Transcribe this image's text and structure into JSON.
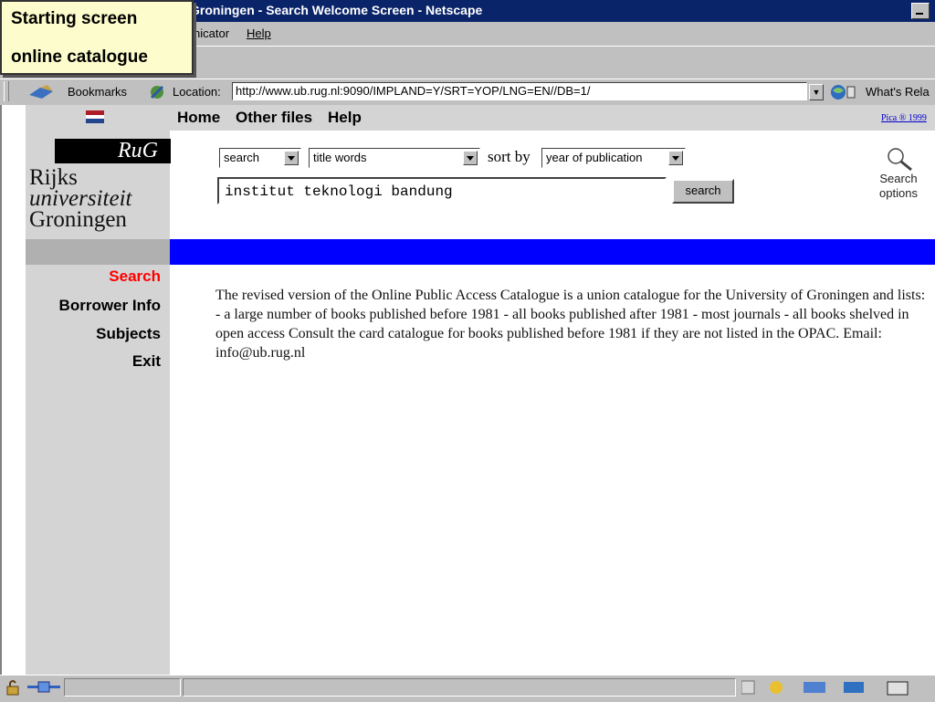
{
  "window": {
    "title": "Groningen - Search Welcome Screen - Netscape"
  },
  "menubar": {
    "items": [
      "nicator",
      "Help"
    ]
  },
  "location_bar": {
    "bookmarks_label": "Bookmarks",
    "location_label": "Location:",
    "url": "http://www.ub.rug.nl:9090/IMPLAND=Y/SRT=YOP/LNG=EN//DB=1/",
    "whats_related": "What's Rela"
  },
  "top_nav": {
    "home": "Home",
    "other_files": "Other files",
    "help": "Help",
    "pica": "Pica ® 1999"
  },
  "logo": {
    "badge": "RuG",
    "line1": "Rijks",
    "line2": "universiteit",
    "line3": "Groningen"
  },
  "search_form": {
    "mode": "search",
    "field": "title words",
    "sort_by_label": "sort by",
    "sort_value": "year of publication",
    "query": "institut teknologi bandung",
    "search_button": "search",
    "options_line1": "Search",
    "options_line2": "options"
  },
  "side_menu": {
    "search": "Search",
    "borrower_info": "Borrower Info",
    "subjects": "Subjects",
    "exit": "Exit"
  },
  "colors": {
    "active_link": "#ff0000",
    "banner": "#0000ff",
    "flag_red": "#ae1c28",
    "flag_white": "#ffffff",
    "flag_blue": "#21468b"
  },
  "intro_text": "The revised version of the Online Public Access Catalogue is a union catalogue for the University of Groningen and lists: - a large number of books published before 1981 - all books published after 1981 - most journals - all books shelved in open access Consult the card catalogue for books published before 1981 if they are not listed in the OPAC. Email: info@ub.rug.nl",
  "overlay_label": {
    "line1": "Starting screen",
    "line2": "online catalogue"
  }
}
